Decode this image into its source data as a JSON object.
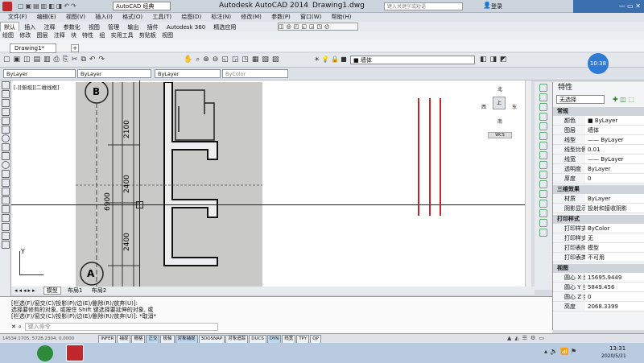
{
  "title_bar": {
    "workspace": "AutoCAD 经典",
    "app_title": "Autodesk AutoCAD 2014",
    "file_name": "Drawing1.dwg",
    "search_placeholder": "键入关键字或短语",
    "login": "登录"
  },
  "menu": [
    "文件(F)",
    "编辑(E)",
    "视图(V)",
    "插入(I)",
    "格式(O)",
    "工具(T)",
    "绘图(D)",
    "标注(N)",
    "修改(M)",
    "参数(P)",
    "窗口(W)",
    "帮助(H)"
  ],
  "ribbon_tabs": [
    "默认",
    "插入",
    "注释",
    "参数化",
    "视图",
    "管理",
    "输出",
    "插件",
    "Autodesk 360",
    "精选应用"
  ],
  "ribbon_subtabs": [
    "绘图",
    "修改",
    "图层",
    "注释",
    "块",
    "特性",
    "组",
    "实用工具",
    "剪贴板",
    "视图"
  ],
  "doc_tab": "Drawing1*",
  "layer_bar": {
    "layer_current": "墙体",
    "color": "ByLayer",
    "linetype": "ByLayer",
    "lineweight": "ByLayer",
    "plotstyle": "ByColor"
  },
  "viewport_label": "[-][俯视][二维线框]",
  "viewcube": {
    "north": "北",
    "south": "南",
    "west": "西",
    "east": "东",
    "top": "上",
    "wcs": "WCS"
  },
  "drawing_annotations": {
    "grid_b": "B",
    "grid_a": "A",
    "dim1": "2100",
    "dim2": "2400",
    "dim3": "2400",
    "dim_total": "6900",
    "axis_y": "Y"
  },
  "clock_badge": "10:38",
  "layout_tabs": [
    "模型",
    "布局1",
    "布局2"
  ],
  "command_lines": [
    "[栏选(F)/窗交(C)/投影(P)/边(E)/删除(R)/放弃(U)]:",
    "选择要修剪的对象, 或按住 Shift 键选择要延伸的对象, 或",
    "[栏选(F)/窗交(C)/投影(P)/边(E)/删除(R)/放弃(U)]: *取消*"
  ],
  "command_prompt": "键入命令",
  "properties": {
    "title": "特性",
    "selection": "无选择",
    "sections": [
      {
        "name": "常规",
        "rows": [
          {
            "k": "颜色",
            "v": "■ ByLayer"
          },
          {
            "k": "图层",
            "v": "墙体"
          },
          {
            "k": "线型",
            "v": "—— ByLayer"
          },
          {
            "k": "线型比例",
            "v": "0.01"
          },
          {
            "k": "线宽",
            "v": "—— ByLayer"
          },
          {
            "k": "透明度",
            "v": "ByLayer"
          },
          {
            "k": "厚度",
            "v": "0"
          }
        ]
      },
      {
        "name": "三维效果",
        "rows": [
          {
            "k": "材质",
            "v": "ByLayer"
          },
          {
            "k": "阴影显示",
            "v": "投射和接收阴影"
          }
        ]
      },
      {
        "name": "打印样式",
        "rows": [
          {
            "k": "打印样式",
            "v": "ByColor"
          },
          {
            "k": "打印样式表",
            "v": "无"
          },
          {
            "k": "打印表附...",
            "v": "模型"
          },
          {
            "k": "打印表类型",
            "v": "不可用"
          }
        ]
      },
      {
        "name": "视图",
        "rows": [
          {
            "k": "圆心 X 坐...",
            "v": "15695.9449"
          },
          {
            "k": "圆心 Y 坐...",
            "v": "5849.456"
          },
          {
            "k": "圆心 Z 坐...",
            "v": "0"
          },
          {
            "k": "高度",
            "v": "2068.3399"
          }
        ]
      }
    ]
  },
  "status_buttons": [
    {
      "label": "INFER",
      "on": false
    },
    {
      "label": "捕捉",
      "on": false
    },
    {
      "label": "栅格",
      "on": false
    },
    {
      "label": "正交",
      "on": true
    },
    {
      "label": "极轴",
      "on": false
    },
    {
      "label": "对象捕捉",
      "on": true
    },
    {
      "label": "3DOSNAP",
      "on": false
    },
    {
      "label": "对象追踪",
      "on": false
    },
    {
      "label": "DUCS",
      "on": false
    },
    {
      "label": "DYN",
      "on": true
    },
    {
      "label": "线宽",
      "on": false
    },
    {
      "label": "TPY",
      "on": false
    },
    {
      "label": "QP",
      "on": false
    }
  ],
  "coords": "14534.1705, 5728.2304, 0.0000",
  "taskbar": {
    "time": "13:31",
    "date": "2020/5/21"
  },
  "colors": {
    "accent_tab": "#2e6db4",
    "red_lines": "#c0282e",
    "drawing_bg": "#c9c9c8"
  }
}
